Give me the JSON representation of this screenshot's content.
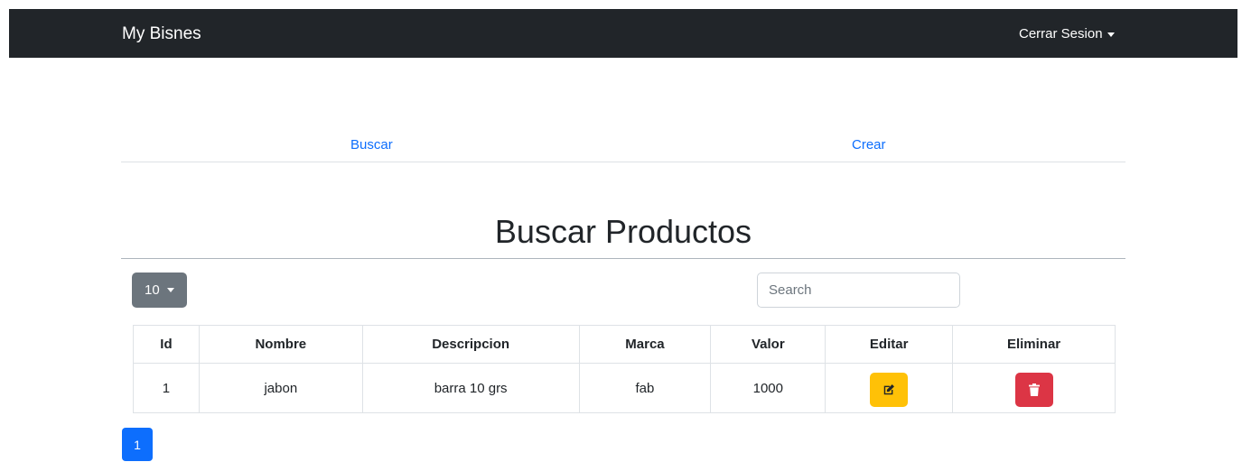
{
  "navbar": {
    "brand": "My Bisnes",
    "user_menu_label": "Cerrar Sesion"
  },
  "tabs": [
    {
      "label": "Buscar"
    },
    {
      "label": "Crear"
    }
  ],
  "page": {
    "title": "Buscar Productos"
  },
  "table_controls": {
    "page_length": "10",
    "search_placeholder": "Search"
  },
  "table": {
    "columns": [
      "Id",
      "Nombre",
      "Descripcion",
      "Marca",
      "Valor",
      "Editar",
      "Eliminar"
    ],
    "rows": [
      {
        "id": "1",
        "nombre": "jabon",
        "descripcion": "barra 10 grs",
        "marca": "fab",
        "valor": "1000",
        "edit_icon": "edit-icon",
        "delete_icon": "trash-icon"
      }
    ]
  },
  "pagination": {
    "pages": [
      "1"
    ],
    "active": "1"
  },
  "colors": {
    "navbar_bg": "#212529",
    "link": "#0d6efd",
    "edit_button": "#ffc107",
    "delete_button": "#dc3545",
    "secondary": "#6c757d",
    "primary": "#0d6efd"
  }
}
